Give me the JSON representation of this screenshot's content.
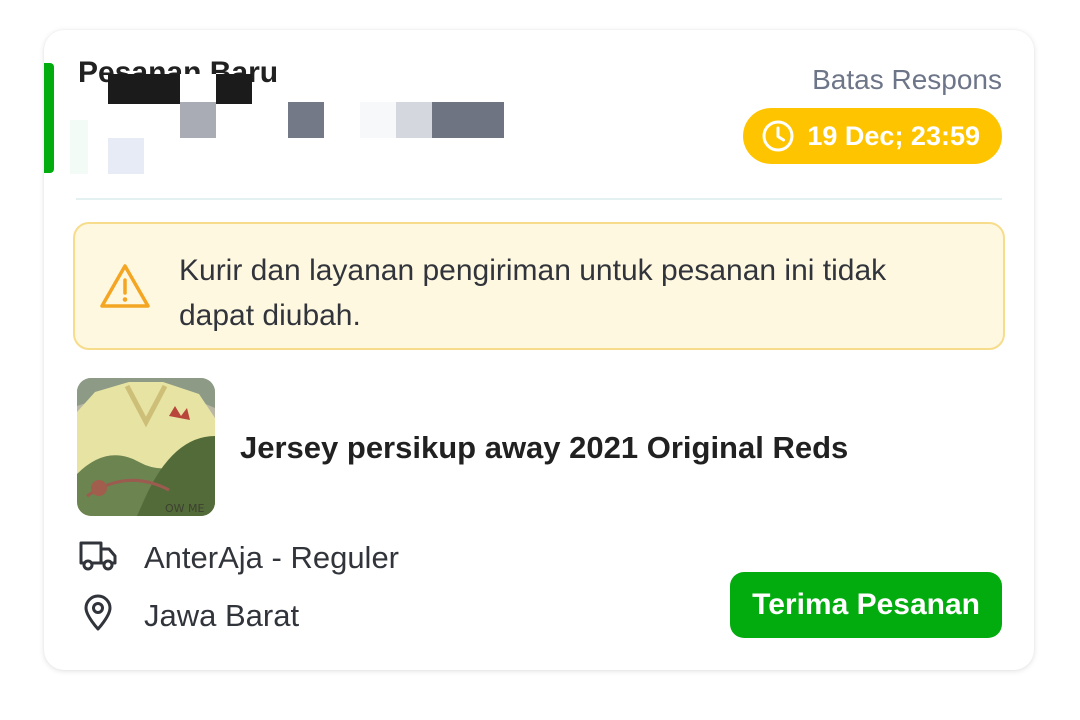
{
  "order": {
    "title": "Pesanan Baru",
    "deadline_label": "Batas Respons",
    "deadline_value": "19 Dec; 23:59",
    "deadline_icon": "clock-icon"
  },
  "warning": {
    "icon": "warning-triangle-icon",
    "text": "Kurir dan layanan pengiriman untuk pesanan ini tidak dapat diubah."
  },
  "product": {
    "name": "Jersey persikup away 2021 Original Reds"
  },
  "shipping": {
    "courier_icon": "truck-icon",
    "courier": "AnterAja - Reguler",
    "location_icon": "location-pin-icon",
    "location": "Jawa Barat"
  },
  "actions": {
    "accept_label": "Terima Pesanan"
  },
  "colors": {
    "brand_green": "#03ac0e",
    "deadline_yellow": "#ffc400",
    "warning_bg": "#fff8e1",
    "warning_border": "#f7dc8b",
    "warning_icon": "#f4a623"
  }
}
